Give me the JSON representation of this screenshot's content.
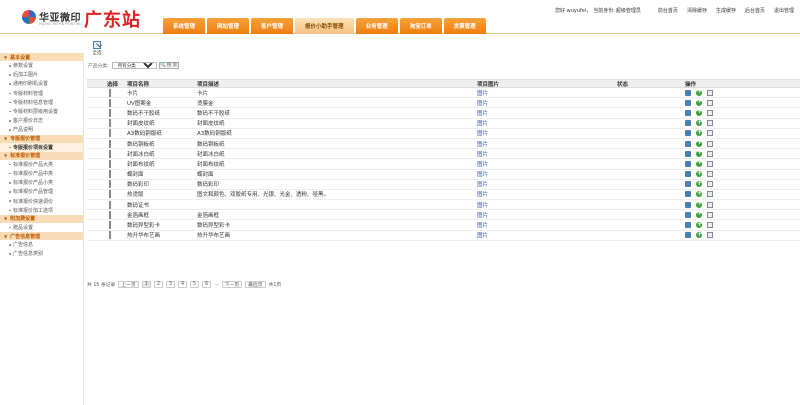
{
  "header": {
    "logo_text": "华亚微印",
    "logo_sub": "HUAYA WEIYIN PRINTING",
    "site_name": "广东站",
    "greeting": "您好 wuyufei，",
    "role_prefix": "当前身份:",
    "role": "超级管理员",
    "links": [
      "前台首页",
      "清除缓存",
      "生成缓存",
      "后台首页",
      "退出管理"
    ]
  },
  "nav": {
    "tabs": [
      {
        "label": "系统管理",
        "active": false
      },
      {
        "label": "网站管理",
        "active": false
      },
      {
        "label": "客户管理",
        "active": false
      },
      {
        "label": "报价小助手管理",
        "active": true
      },
      {
        "label": "业务管理",
        "active": false
      },
      {
        "label": "淘宝订单",
        "active": false
      },
      {
        "label": "发票管理",
        "active": false
      }
    ]
  },
  "sidebar": {
    "groups": [
      {
        "title": "基本设置",
        "items": [
          "参数设置",
          "后加工图片",
          "通用印刷机设置",
          "专版材料管理",
          "专版材料信息管理",
          "专版材料层级用设置",
          "客户报价日志",
          "产品说明"
        ]
      },
      {
        "title": "专版报价管理",
        "items": [
          "专版报价项目设置"
        ]
      },
      {
        "title": "标准报价管理",
        "items": [
          "标准报价产品大类",
          "标准报价产品中类",
          "标准报价产品小类",
          "标准报价产品管理",
          "标准报价快速调价",
          "标准报价加工选项"
        ]
      },
      {
        "title": "附加费设置",
        "items": [
          "赠品设置"
        ]
      },
      {
        "title": "广告信息管理",
        "items": [
          "广告信息",
          "广告信息类别"
        ]
      }
    ],
    "active_item": "专版报价项目设置"
  },
  "toolbar": {
    "select_all_label": "全选"
  },
  "filter": {
    "label": "产品分类:",
    "selected_option": "所有分类",
    "search_label": "搜 索"
  },
  "table": {
    "headers": [
      "选择",
      "项目名称",
      "项目描述",
      "项目图片",
      "状态",
      "操作"
    ],
    "image_link_text": "图片",
    "rows": [
      {
        "name": "卡片",
        "desc": "卡片"
      },
      {
        "name": "UV图案金",
        "desc": "烫膜金"
      },
      {
        "name": "数码不干胶纸",
        "desc": "数码不干胶纸"
      },
      {
        "name": "封面皮纹纸",
        "desc": "封面皮纹纸"
      },
      {
        "name": "A3数码铜版纸",
        "desc": "A3数码铜版纸"
      },
      {
        "name": "数码铜板纸",
        "desc": "数码铜板纸"
      },
      {
        "name": "封面冰白纸",
        "desc": "封面冰白纸"
      },
      {
        "name": "封面布纹纸",
        "desc": "封面布纹纸"
      },
      {
        "name": "蝶封面",
        "desc": "蝶封面"
      },
      {
        "name": "数码彩印",
        "desc": "数码彩印"
      },
      {
        "name": "热烫版",
        "desc": "图文和颜色、双胶纸专用、光银、光金、透粉、哑黑。"
      },
      {
        "name": "数码证书",
        "desc": ""
      },
      {
        "name": "金箔画框",
        "desc": "金箔画框"
      },
      {
        "name": "数码异型彩卡",
        "desc": "数码异型彩卡"
      },
      {
        "name": "热升华布艺画",
        "desc": "热升华布艺画"
      }
    ]
  },
  "pager": {
    "summary": "共 15 条记录",
    "first": "上一页",
    "pages": [
      "1",
      "2",
      "3",
      "4",
      "5",
      "6"
    ],
    "ellipsis": "...",
    "next": "下一页",
    "last": "最后页",
    "total_pages": "共1页"
  }
}
